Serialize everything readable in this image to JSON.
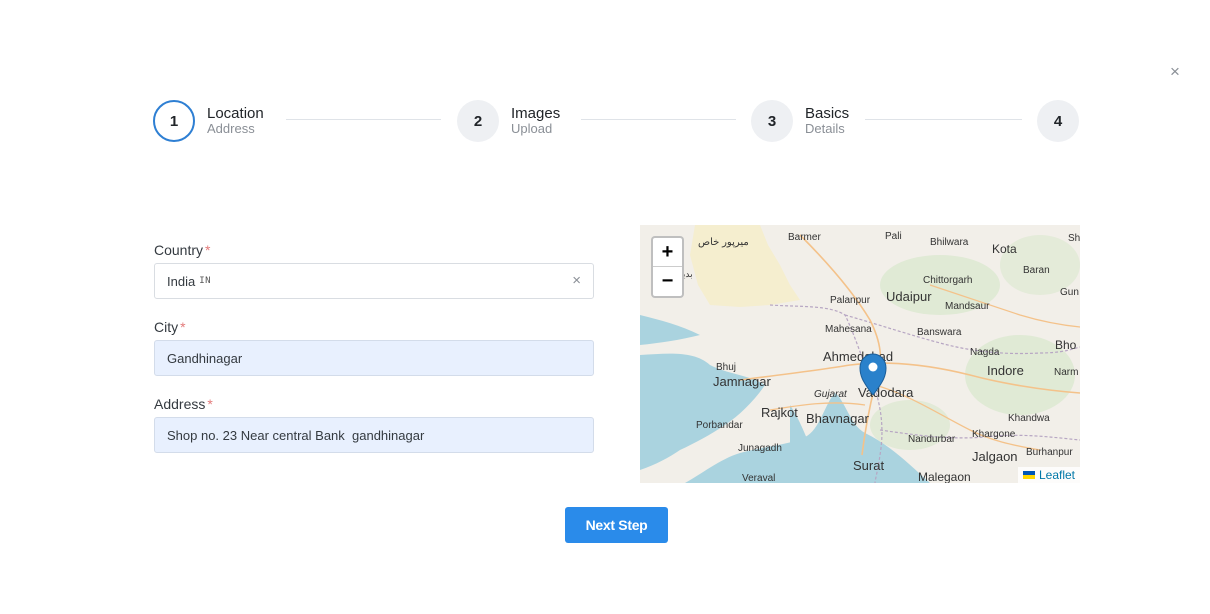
{
  "dialog": {
    "close_label": "×"
  },
  "stepper": {
    "steps": [
      {
        "number": "1",
        "title": "Location",
        "subtitle": "Address",
        "active": true
      },
      {
        "number": "2",
        "title": "Images",
        "subtitle": "Upload",
        "active": false
      },
      {
        "number": "3",
        "title": "Basics",
        "subtitle": "Details",
        "active": false
      },
      {
        "number": "4",
        "title": "",
        "subtitle": "",
        "active": false
      }
    ]
  },
  "form": {
    "country": {
      "label": "Country",
      "required_mark": "*",
      "value": "India",
      "code": "IN",
      "clear_label": "×"
    },
    "city": {
      "label": "City",
      "required_mark": "*",
      "value": "Gandhinagar"
    },
    "address": {
      "label": "Address",
      "required_mark": "*",
      "value": "Shop no. 23 Near central Bank  gandhinagar"
    }
  },
  "map": {
    "zoom_in": "+",
    "zoom_out": "−",
    "attribution": "Leaflet",
    "places": {
      "barmer": "Barmer",
      "pali": "Pali",
      "bhilwara": "Bhilwara",
      "kota": "Kota",
      "sh": "Sh",
      "baran": "Baran",
      "chittorgarh": "Chittorgarh",
      "gun": "Gun",
      "palanpur": "Palanpur",
      "udaipur": "Udaipur",
      "mandsaur": "Mandsaur",
      "mahesana": "Mahesana",
      "banswara": "Banswara",
      "ahmedabad": "Ahmedabad",
      "nagda": "Nagda",
      "bho": "Bho",
      "bhuj": "Bhuj",
      "indore": "Indore",
      "narm": "Narm",
      "jamnagar": "Jamnagar",
      "gujarat": "Gujarat",
      "vadodara": "Vadodara",
      "rajkot": "Rajkot",
      "bhavnagar": "Bhavnagar",
      "khandwa": "Khandwa",
      "porbandar": "Porbandar",
      "khargone": "Khargone",
      "nandurbar": "Nandurbar",
      "burhanpur": "Burhanpur",
      "junagadh": "Junagadh",
      "jalgaon": "Jalgaon",
      "surat": "Surat",
      "veraval": "Veraval",
      "malegaon": "Malegaon",
      "mirpur_khas": "میرپور خاص",
      "badin": "بدین"
    }
  },
  "actions": {
    "next_label": "Next Step"
  },
  "colors": {
    "primary": "#2a8bea",
    "active_step": "#2e7fd3",
    "required": "#e37a7a",
    "filled_bg": "#e8f0fe"
  }
}
